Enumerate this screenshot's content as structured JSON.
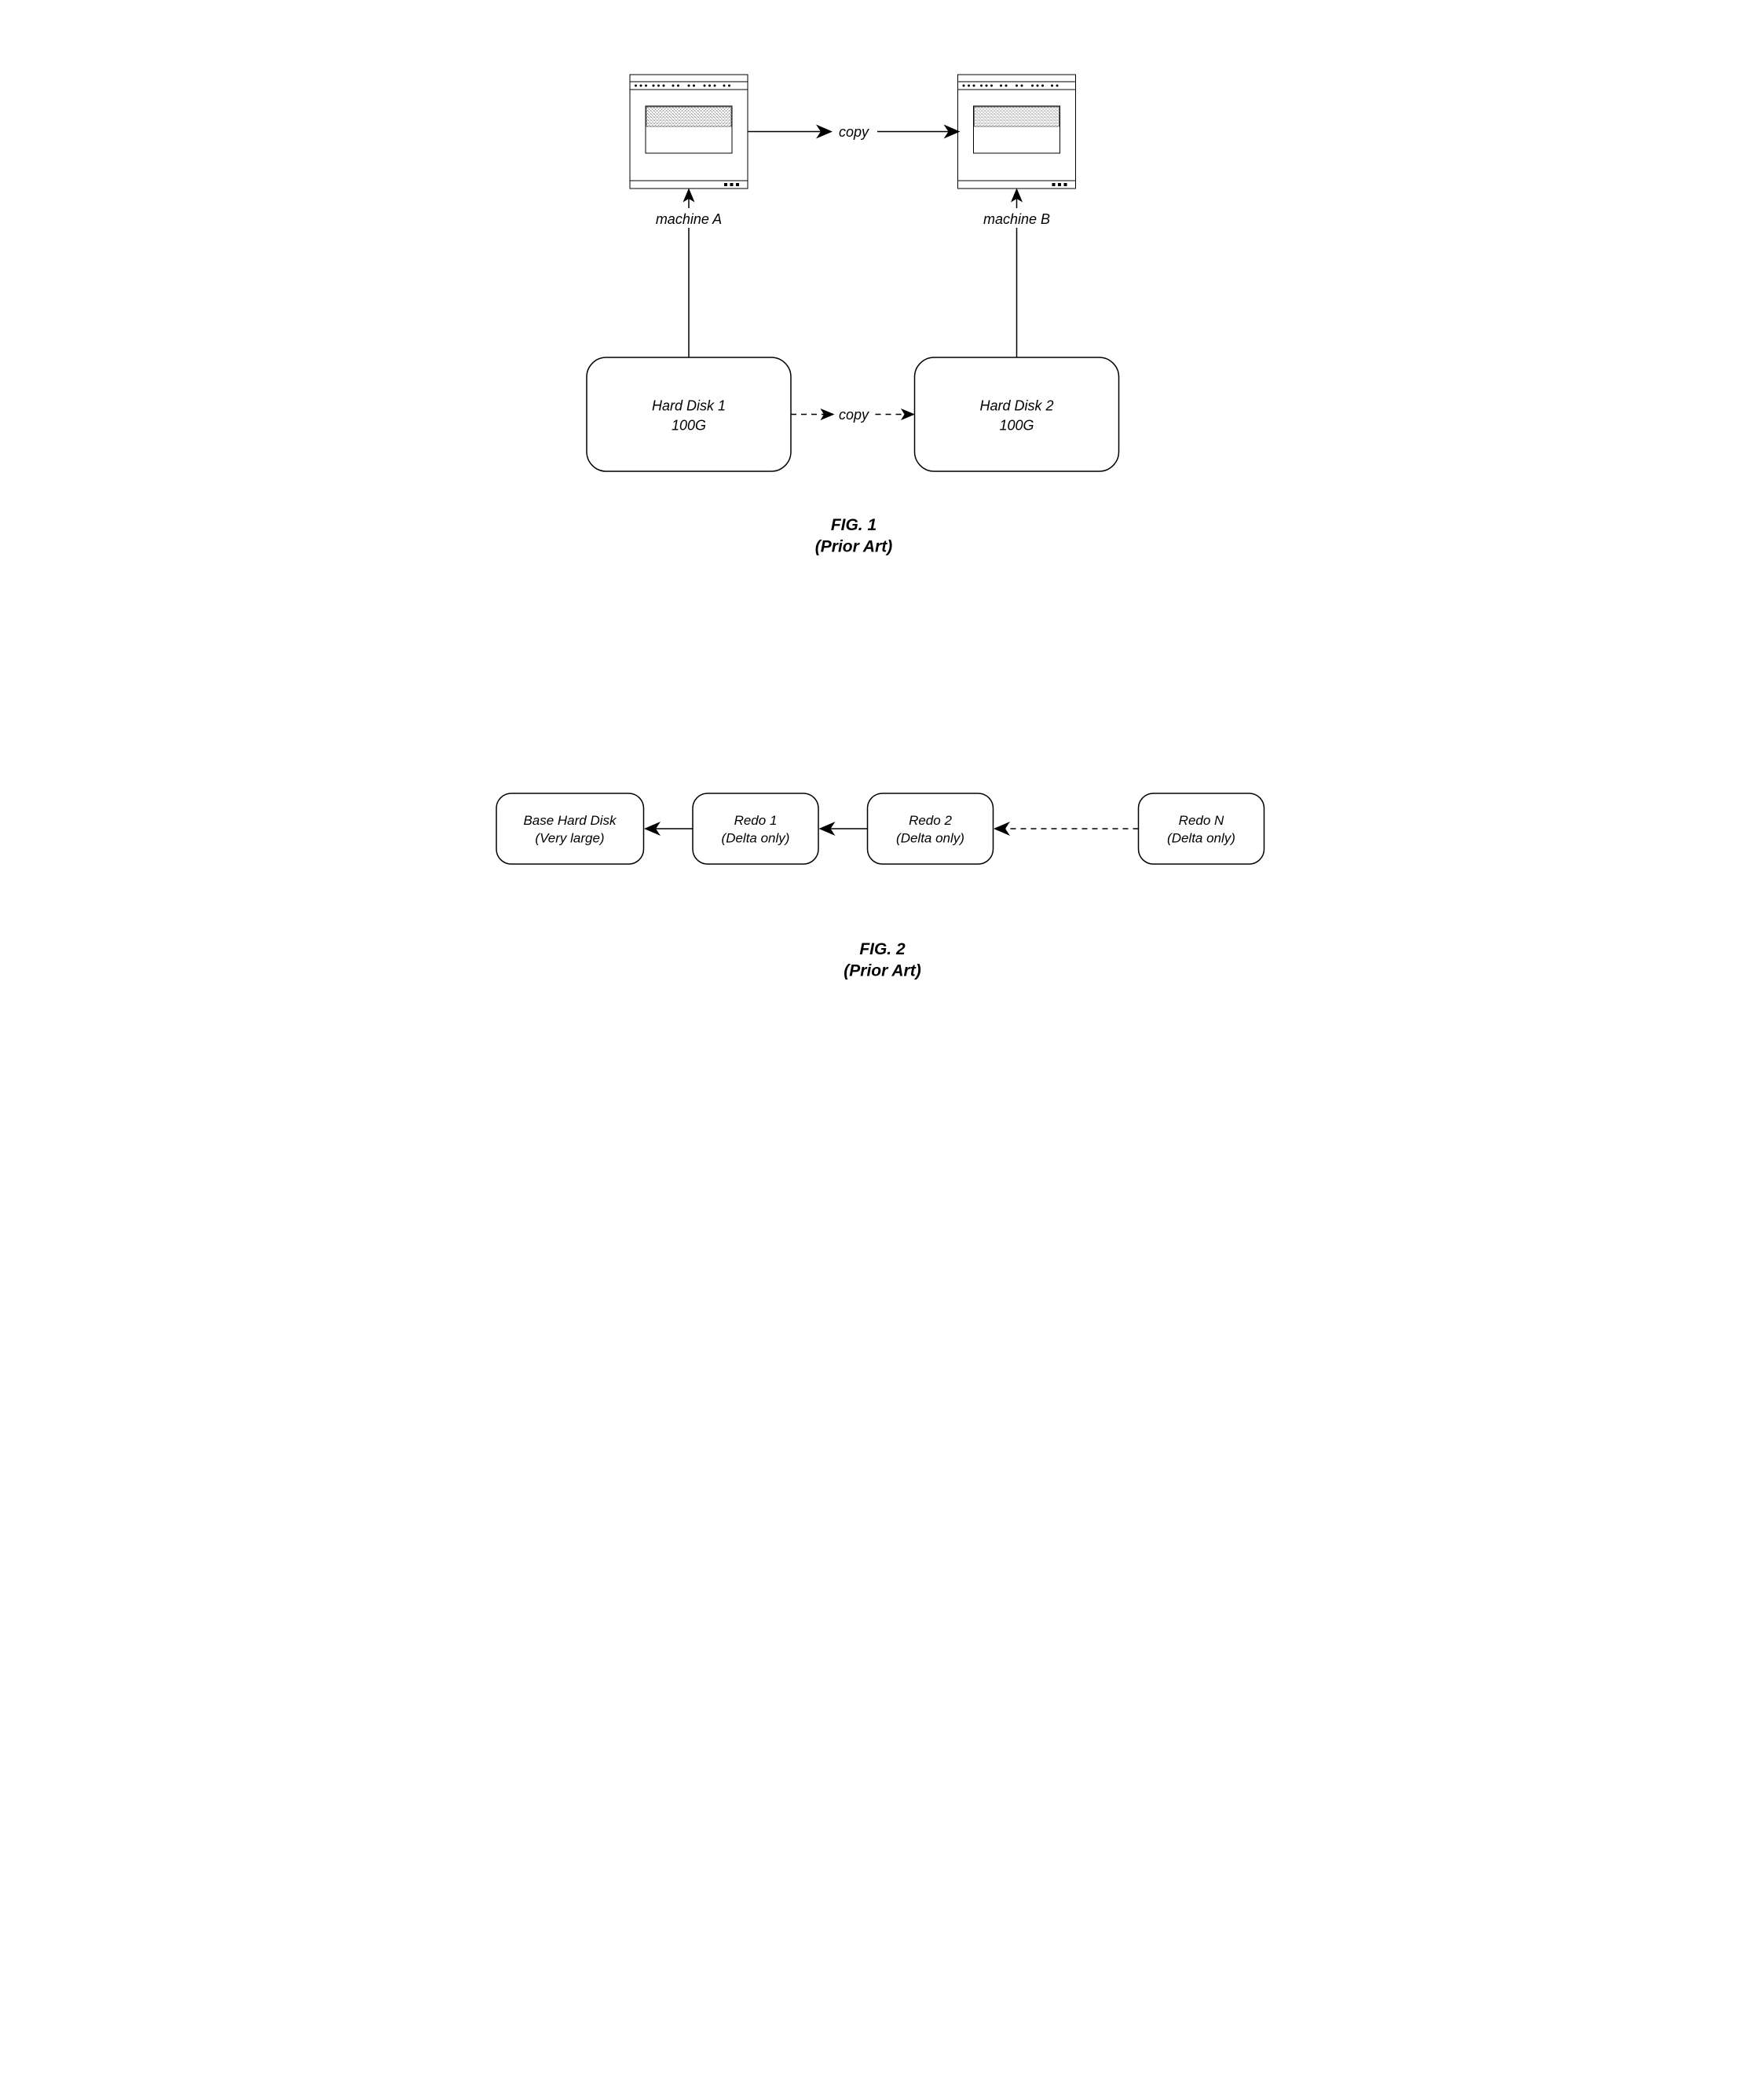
{
  "fig1": {
    "machineA": "machine A",
    "machineB": "machine B",
    "disk1_line1": "Hard Disk 1",
    "disk1_line2": "100G",
    "disk2_line1": "Hard Disk 2",
    "disk2_line2": "100G",
    "copy_top": "copy",
    "copy_mid": "copy",
    "caption_line1": "FIG. 1",
    "caption_line2": "(Prior Art)"
  },
  "fig2": {
    "box1_line1": "Base Hard Disk",
    "box1_line2": "(Very large)",
    "box2_line1": "Redo 1",
    "box2_line2": "(Delta only)",
    "box3_line1": "Redo 2",
    "box3_line2": "(Delta only)",
    "box4_line1": "Redo N",
    "box4_line2": "(Delta only)",
    "caption_line1": "FIG. 2",
    "caption_line2": "(Prior Art)"
  }
}
